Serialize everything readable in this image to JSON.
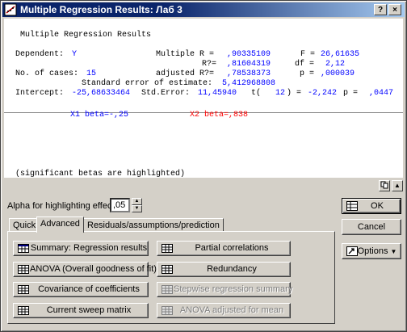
{
  "window": {
    "title": "Multiple Regression Results: Лаб 3",
    "help_btn": "?",
    "close_btn": "×"
  },
  "report": {
    "header": "Multiple Regression Results",
    "dependent_label": "Dependent:",
    "dependent_value": "Y",
    "multiple_r_label": "Multiple R =",
    "multiple_r_value": ",90335109",
    "f_label": "F =",
    "f_value": "26,61635",
    "r2_label": "R?=",
    "r2_value": ",81604319",
    "df_label": "df =",
    "df_value": "2,12",
    "cases_label": "No. of cases:",
    "cases_value": "15",
    "adj_r2_label": "adjusted R?=",
    "adj_r2_value": ",78538373",
    "p_label": "p =",
    "p_value": ",000039",
    "se_label": "Standard error of estimate:",
    "se_value": "5,412968808",
    "intercept_label": "Intercept:",
    "intercept_value": "-25,68633464",
    "std_error_label": "Std.Error:",
    "std_error_value": "11,45940",
    "t_label": "t(",
    "t_df": "12",
    "t_close": ") =",
    "t_value": "-2,242",
    "p2_label": "p =",
    "p2_value": ",0447",
    "x1_beta": "X1 beta=-,25",
    "x2_beta": "X2 beta=,838",
    "footnote": "(significant betas are highlighted)"
  },
  "controls": {
    "alpha_label": "Alpha for highlighting effects:",
    "alpha_value": ",05"
  },
  "tabs": [
    {
      "label": "Quick"
    },
    {
      "label": "Advanced"
    },
    {
      "label": "Residuals/assumptions/prediction"
    }
  ],
  "buttons": {
    "summary": "Summary:  Regression results",
    "anova": "ANOVA (Overall goodness of fit)",
    "covariance": "Covariance of coefficients",
    "sweep": "Current sweep matrix",
    "partial": "Partial correlations",
    "redundancy": "Redundancy",
    "stepwise": "Stepwise regression summary",
    "anova_adjusted": "ANOVA adjusted for mean"
  },
  "right": {
    "ok": "OK",
    "cancel": "Cancel",
    "options": "Options"
  }
}
